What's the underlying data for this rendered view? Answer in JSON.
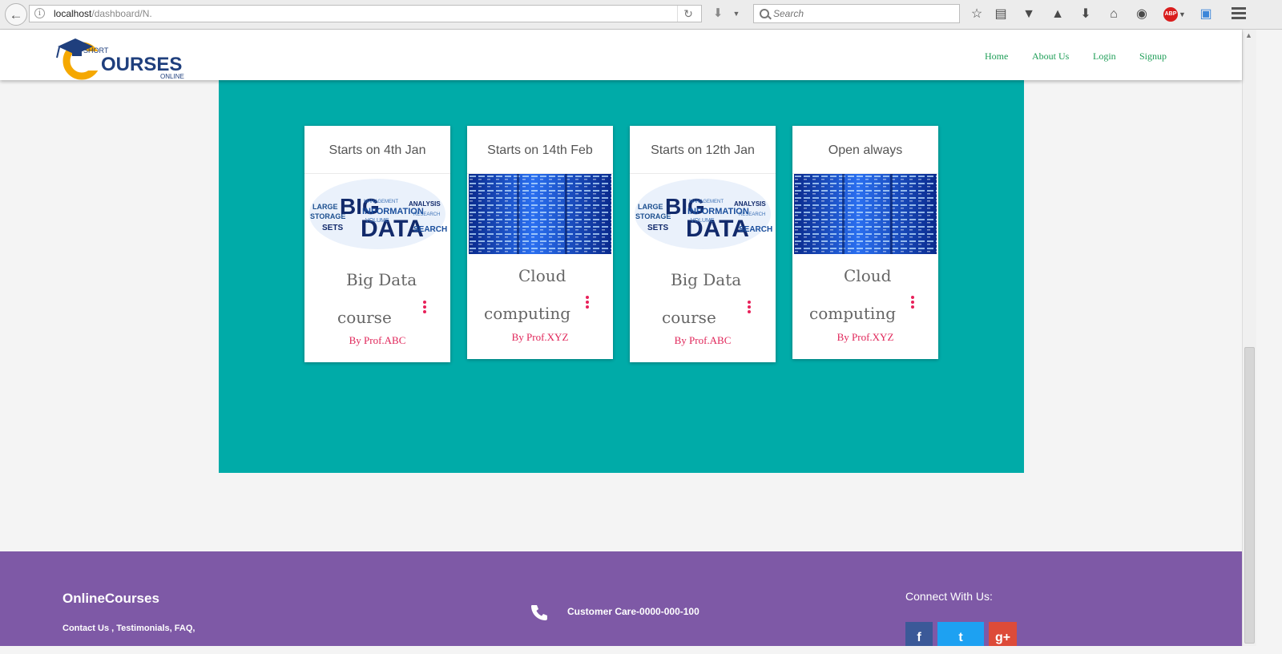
{
  "browser": {
    "url_host": "localhost",
    "url_path": "/dashboard/N.",
    "search_placeholder": "Search",
    "abp_label": "ABP"
  },
  "header": {
    "logo": {
      "line1": "SHORT",
      "main": "OURSES",
      "initial": "C",
      "line2": "ONLINE"
    },
    "nav": [
      "Home",
      "About Us",
      "Login",
      "Signup"
    ]
  },
  "cards": [
    {
      "date": "Starts on 4th Jan",
      "image": "big-data-word-cloud",
      "title_line1": "Big Data",
      "title_line2": "course",
      "author": "By Prof.ABC"
    },
    {
      "date": "Starts on 14th Feb",
      "image": "server-rack",
      "title_line1": "Cloud",
      "title_line2": "computing",
      "author": "By Prof.XYZ"
    },
    {
      "date": "Starts on 12th Jan",
      "image": "big-data-word-cloud",
      "title_line1": "Big Data",
      "title_line2": "course",
      "author": "By Prof.ABC"
    },
    {
      "date": "Open always",
      "image": "server-rack",
      "title_line1": "Cloud",
      "title_line2": "computing",
      "author": "By Prof.XYZ"
    }
  ],
  "wordcloud": {
    "big": "BIG",
    "data": "DATA",
    "large": "LARGE",
    "storage": "STORAGE",
    "information": "INFORMATION",
    "analysis": "ANALYSIS",
    "sets": "SETS",
    "search": "SEARCH",
    "management": "MANAGEMENT",
    "research": "RESEARCH",
    "volume": "VOLUME"
  },
  "footer": {
    "brand": "OnlineCourses",
    "links": "Contact Us , Testimonials, FAQ,",
    "care": "Customer Care-0000-000-100",
    "connect": "Connect With Us:",
    "social": [
      "f",
      "t",
      "g+"
    ]
  },
  "colors": {
    "teal": "#00aba8",
    "footer": "#7e59a6",
    "nav": "#1e9e57",
    "accent": "#e02458"
  }
}
